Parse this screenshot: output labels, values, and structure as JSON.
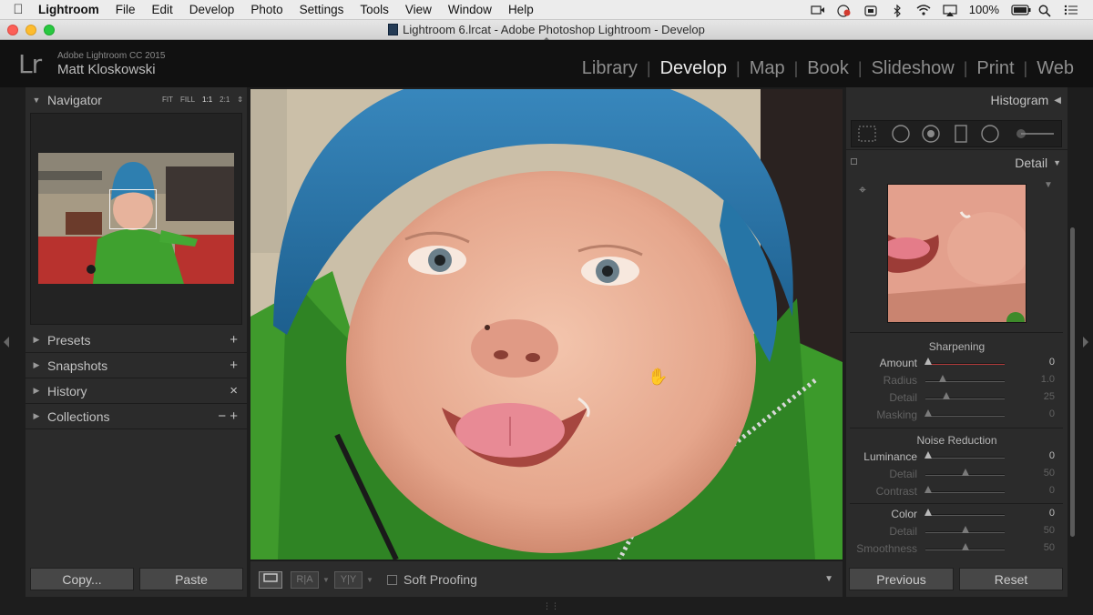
{
  "menubar": {
    "app": "Lightroom",
    "items": [
      "File",
      "Edit",
      "Develop",
      "Photo",
      "Settings",
      "Tools",
      "View",
      "Window",
      "Help"
    ],
    "battery": "100%"
  },
  "window": {
    "title": "Lightroom 6.lrcat - Adobe Photoshop Lightroom - Develop"
  },
  "identity": {
    "logo": "Lr",
    "product": "Adobe Lightroom CC 2015",
    "user": "Matt Kloskowski"
  },
  "modules": [
    "Library",
    "Develop",
    "Map",
    "Book",
    "Slideshow",
    "Print",
    "Web"
  ],
  "modules_separator": "|",
  "active_module": "Develop",
  "left_panel": {
    "navigator": {
      "title": "Navigator",
      "zoom": [
        "FIT",
        "FILL",
        "1:1",
        "2:1"
      ]
    },
    "sections": [
      {
        "title": "Presets",
        "action": "+"
      },
      {
        "title": "Snapshots",
        "action": "+"
      },
      {
        "title": "History",
        "action": "×"
      },
      {
        "title": "Collections",
        "action": "− +"
      }
    ],
    "copy_label": "Copy...",
    "paste_label": "Paste"
  },
  "toolbar": {
    "soft_proofing": "Soft Proofing",
    "before_after_1": "R|A",
    "before_after_2": "Y|Y"
  },
  "right_panel": {
    "histogram_title": "Histogram",
    "detail_title": "Detail",
    "sharpening": {
      "title": "Sharpening",
      "rows": [
        {
          "label": "Amount",
          "value": "0",
          "pos": 0.03,
          "dim": false
        },
        {
          "label": "Radius",
          "value": "1.0",
          "pos": 0.22,
          "dim": true
        },
        {
          "label": "Detail",
          "value": "25",
          "pos": 0.27,
          "dim": true
        },
        {
          "label": "Masking",
          "value": "0",
          "pos": 0.03,
          "dim": true
        }
      ]
    },
    "noise": {
      "title": "Noise Reduction",
      "rows": [
        {
          "label": "Luminance",
          "value": "0",
          "pos": 0.03,
          "dim": false
        },
        {
          "label": "Detail",
          "value": "50",
          "pos": 0.5,
          "dim": true
        },
        {
          "label": "Contrast",
          "value": "0",
          "pos": 0.03,
          "dim": true
        },
        {
          "label": "Color",
          "value": "0",
          "pos": 0.03,
          "dim": false
        },
        {
          "label": "Detail",
          "value": "50",
          "pos": 0.5,
          "dim": true
        },
        {
          "label": "Smoothness",
          "value": "50",
          "pos": 0.5,
          "dim": true
        }
      ]
    },
    "previous_label": "Previous",
    "reset_label": "Reset"
  },
  "colors": {
    "accent_amount": "#b03a3a",
    "panel": "#2b2b2b",
    "background": "#1d1d1d"
  }
}
